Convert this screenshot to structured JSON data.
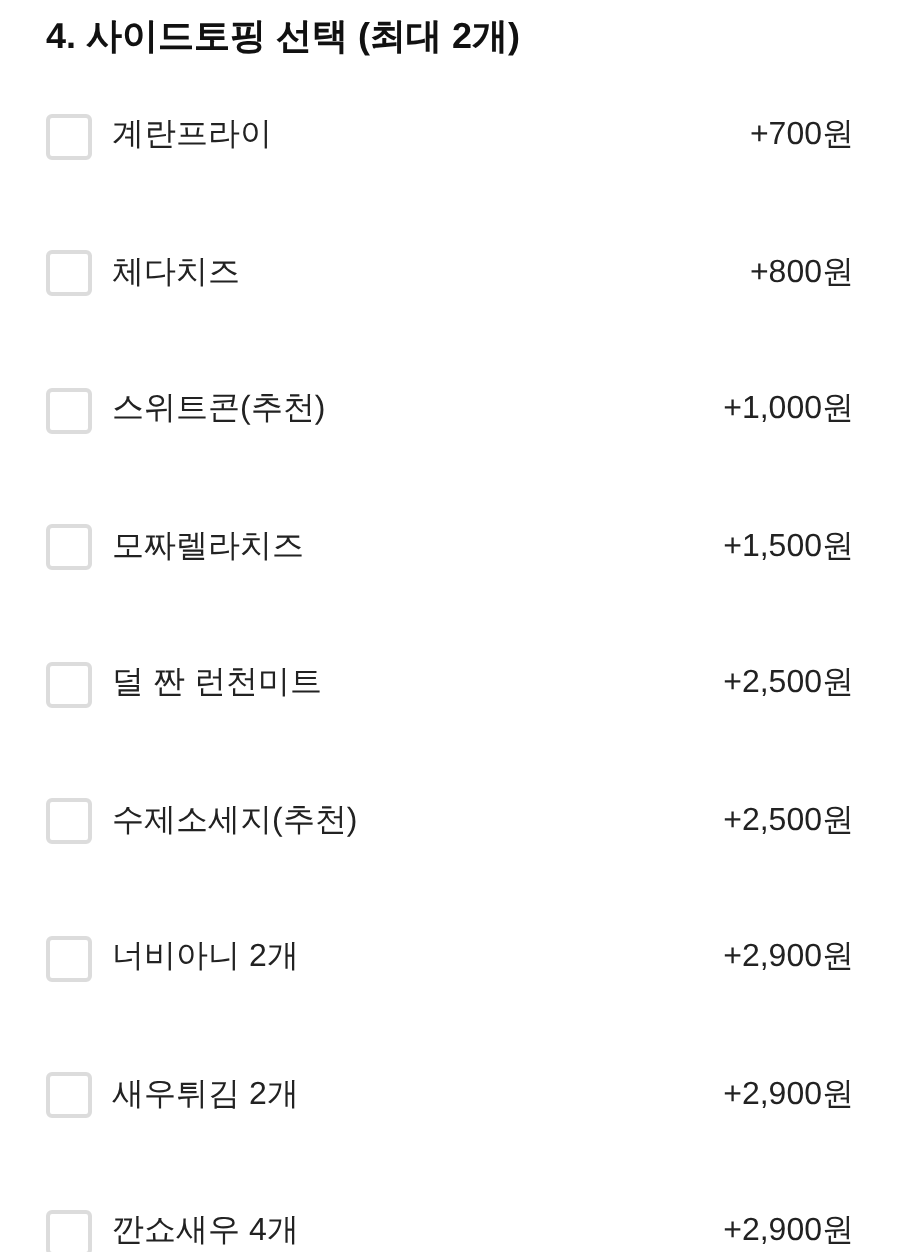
{
  "section_title": "4. 사이드토핑 선택 (최대 2개)",
  "options": [
    {
      "label": "계란프라이",
      "price": "+700원",
      "checked": false
    },
    {
      "label": "체다치즈",
      "price": "+800원",
      "checked": false
    },
    {
      "label": "스위트콘(추천)",
      "price": "+1,000원",
      "checked": false
    },
    {
      "label": "모짜렐라치즈",
      "price": "+1,500원",
      "checked": false
    },
    {
      "label": "덜 짠 런천미트",
      "price": "+2,500원",
      "checked": false
    },
    {
      "label": "수제소세지(추천)",
      "price": "+2,500원",
      "checked": false
    },
    {
      "label": "너비아니 2개",
      "price": "+2,900원",
      "checked": false
    },
    {
      "label": "새우튀김 2개",
      "price": "+2,900원",
      "checked": false
    },
    {
      "label": "깐쇼새우 4개",
      "price": "+2,900원",
      "checked": false
    }
  ]
}
